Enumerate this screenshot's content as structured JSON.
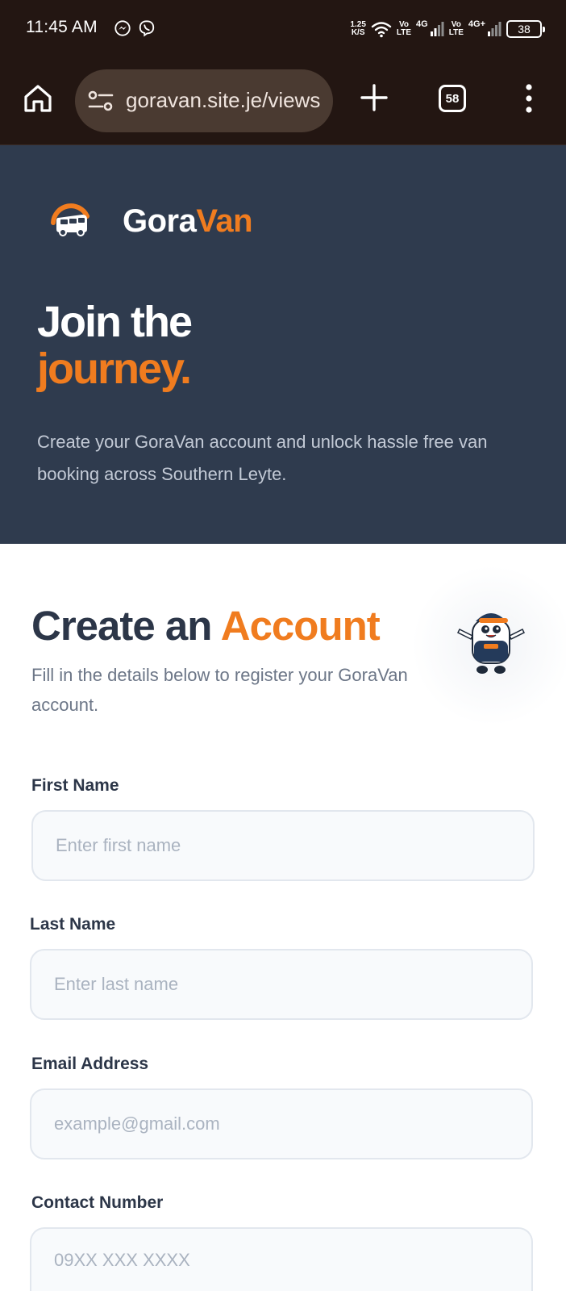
{
  "status_bar": {
    "time": "11:45 AM",
    "net_speed_value": "1.25",
    "net_speed_unit": "K/S",
    "sim1_volte_top": "Vo",
    "sim1_volte_bottom": "LTE",
    "sim1_type": "4G",
    "sim2_volte_top": "Vo",
    "sim2_volte_bottom": "LTE",
    "sim2_type": "4G+",
    "battery": "38",
    "icons": [
      "messenger-icon",
      "viber-icon",
      "wifi-icon",
      "signal-icon",
      "battery-icon"
    ]
  },
  "browser": {
    "url": "goravan.site.je/views",
    "tab_count": "58",
    "icons": [
      "home-icon",
      "tune-icon",
      "plus-icon",
      "menu-dots-icon"
    ]
  },
  "hero": {
    "brand_part1": "Gora",
    "brand_part2": "Van",
    "title_line1": "Join the",
    "title_line2": "journey.",
    "description": "Create your GoraVan account and unlock hassle free van booking across Southern Leyte."
  },
  "form": {
    "title_part1": "Create an",
    "title_part2": "Account",
    "subtitle": "Fill in the details below to register your GoraVan account.",
    "fields": {
      "first_name": {
        "label": "First Name",
        "placeholder": "Enter first name"
      },
      "last_name": {
        "label": "Last Name",
        "placeholder": "Enter last name"
      },
      "email": {
        "label": "Email Address",
        "placeholder": "example@gmail.com"
      },
      "contact": {
        "label": "Contact Number",
        "placeholder": "09XX XXX XXXX"
      }
    }
  },
  "colors": {
    "accent": "#f07c1f",
    "hero_bg": "#2f3b4e",
    "browser_bg": "#231612",
    "heading": "#2c3648"
  }
}
